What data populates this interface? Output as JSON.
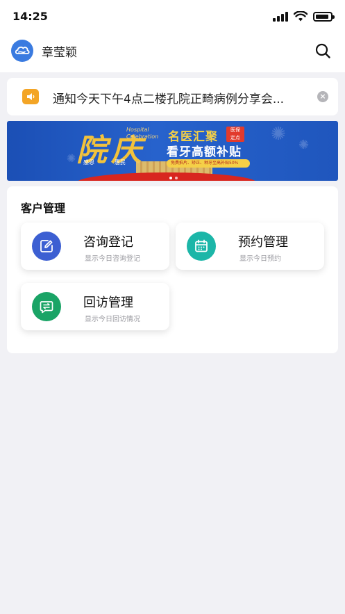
{
  "status_bar": {
    "time": "14:25"
  },
  "header": {
    "user_name": "章莹颖"
  },
  "notice": {
    "text": "通知今天下午4点二楼孔院正畸病例分享会..."
  },
  "banner": {
    "big_text": "院庆",
    "small_text_line1": "Hospital",
    "small_text_line2": "Celebration",
    "sub_text_1": "感恩",
    "sub_text_2": "惠民",
    "title_line1": "名医汇聚",
    "badge_line1": "医保",
    "badge_line2": "定点",
    "title_line2": "看牙高额补贴",
    "pill_text": "免费拍片、矫正、种牙至高补贴50%"
  },
  "customer_management": {
    "title": "客户管理",
    "items": [
      {
        "name": "咨询登记",
        "desc": "显示今日咨询登记",
        "icon": "edit-icon",
        "color": "#3c5fd2"
      },
      {
        "name": "预约管理",
        "desc": "显示今日预约",
        "icon": "calendar-icon",
        "color": "#1cb6a8"
      },
      {
        "name": "回访管理",
        "desc": "显示今日回访情况",
        "icon": "exchange-icon",
        "color": "#1aa466"
      }
    ]
  }
}
